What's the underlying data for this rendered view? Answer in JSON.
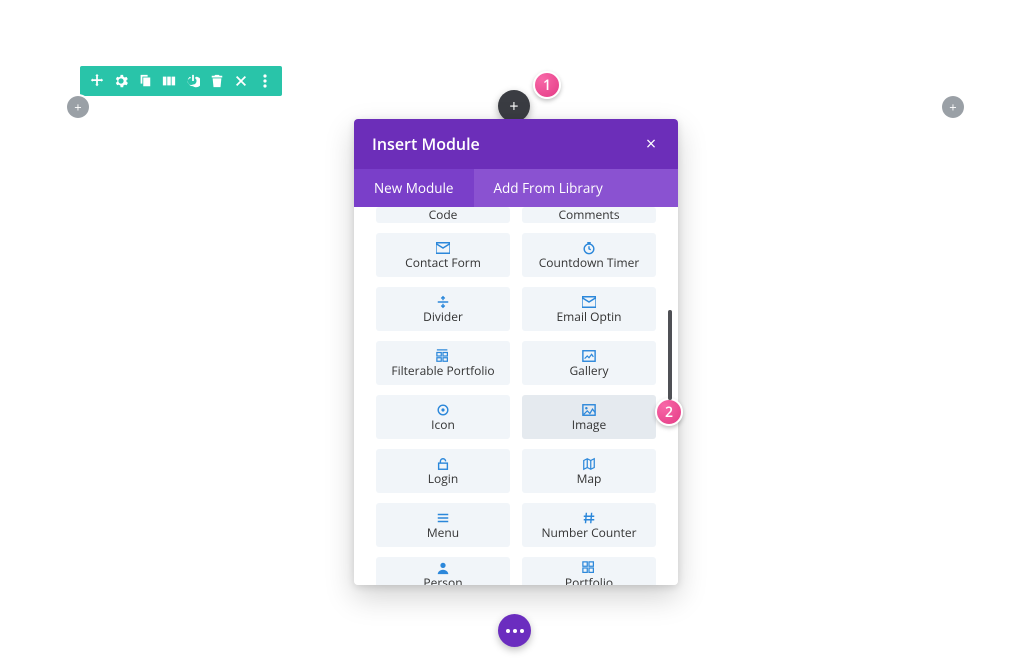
{
  "toolbar_icons": [
    "move",
    "gear",
    "clone",
    "columns",
    "power",
    "trash",
    "close",
    "dots"
  ],
  "row_add_label": "+",
  "col_plus_label": "+",
  "page_actions_label": "•••",
  "callouts": {
    "c1": "1",
    "c2": "2"
  },
  "modal": {
    "title": "Insert Module",
    "close_label": "×",
    "tabs": {
      "new": "New Module",
      "library": "Add From Library"
    },
    "modules": [
      {
        "id": "code",
        "label": "Code",
        "icon": "code"
      },
      {
        "id": "comments",
        "label": "Comments",
        "icon": "comment"
      },
      {
        "id": "contact-form",
        "label": "Contact Form",
        "icon": "envelope"
      },
      {
        "id": "countdown-timer",
        "label": "Countdown Timer",
        "icon": "clock"
      },
      {
        "id": "divider",
        "label": "Divider",
        "icon": "divider"
      },
      {
        "id": "email-optin",
        "label": "Email Optin",
        "icon": "envelope"
      },
      {
        "id": "filterable-portfolio",
        "label": "Filterable Portfolio",
        "icon": "grid"
      },
      {
        "id": "gallery",
        "label": "Gallery",
        "icon": "image-frame"
      },
      {
        "id": "icon",
        "label": "Icon",
        "icon": "target"
      },
      {
        "id": "image",
        "label": "Image",
        "icon": "image"
      },
      {
        "id": "login",
        "label": "Login",
        "icon": "lock"
      },
      {
        "id": "map",
        "label": "Map",
        "icon": "map"
      },
      {
        "id": "menu",
        "label": "Menu",
        "icon": "menu"
      },
      {
        "id": "number-counter",
        "label": "Number Counter",
        "icon": "hash"
      },
      {
        "id": "person",
        "label": "Person",
        "icon": "person"
      },
      {
        "id": "portfolio",
        "label": "Portfolio",
        "icon": "grid"
      }
    ]
  }
}
